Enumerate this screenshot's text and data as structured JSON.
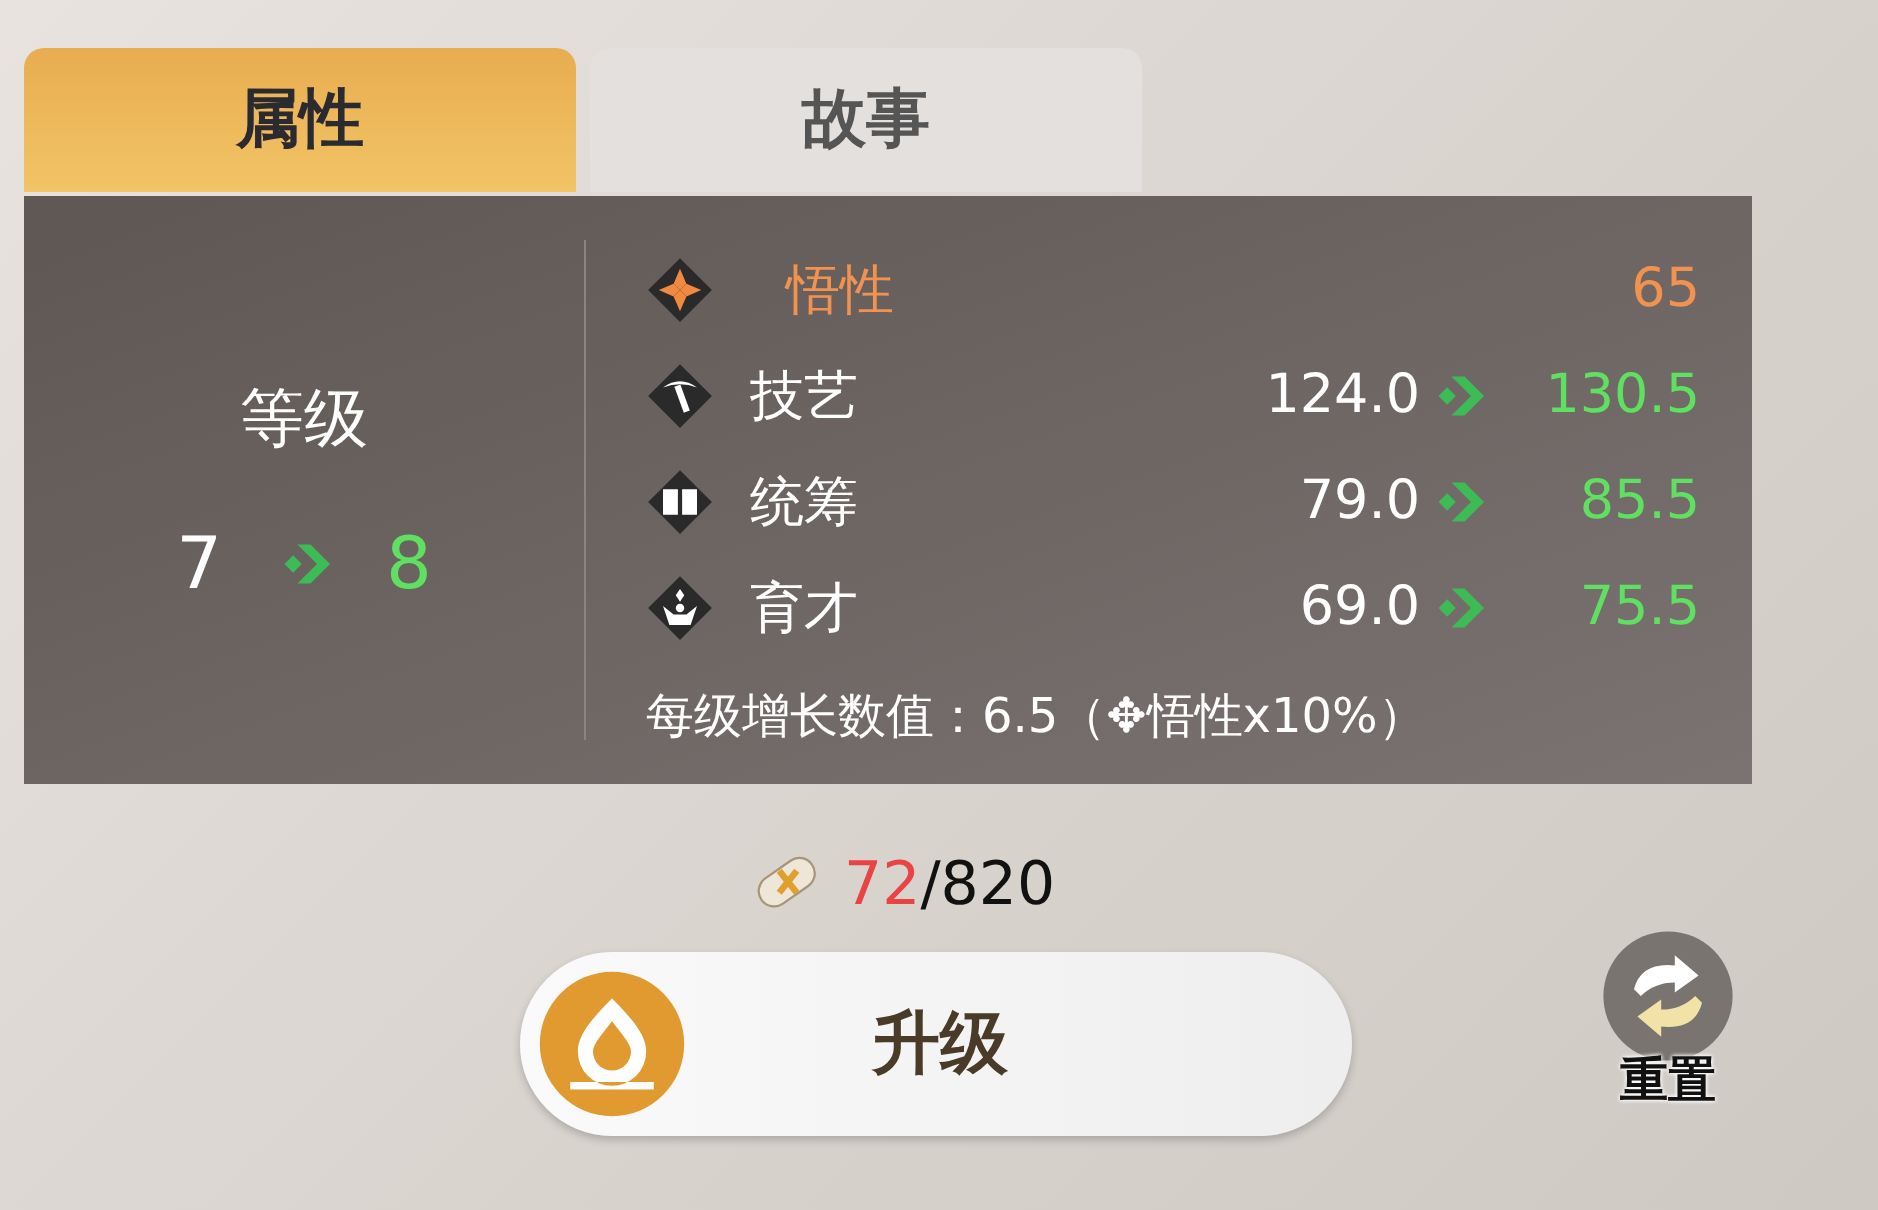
{
  "tabs": [
    {
      "label": "属性",
      "selected": true
    },
    {
      "label": "故事",
      "selected": false
    }
  ],
  "level": {
    "label": "等级",
    "from": "7",
    "to": "8"
  },
  "stats": [
    {
      "kind": "base",
      "name": "悟性",
      "value": "65"
    },
    {
      "kind": "growth",
      "name": "技艺",
      "from": "124.0",
      "to": "130.5"
    },
    {
      "kind": "growth",
      "name": "统筹",
      "from": "79.0",
      "to": "85.5"
    },
    {
      "kind": "growth",
      "name": "育才",
      "from": "69.0",
      "to": "75.5"
    }
  ],
  "note": "每级增长数值：6.5（✥悟性x10%）",
  "cost": {
    "current": "72",
    "total": "/820",
    "insufficient": true
  },
  "upgrade_button": {
    "label": "升级"
  },
  "reset_button": {
    "label": "重置"
  }
}
